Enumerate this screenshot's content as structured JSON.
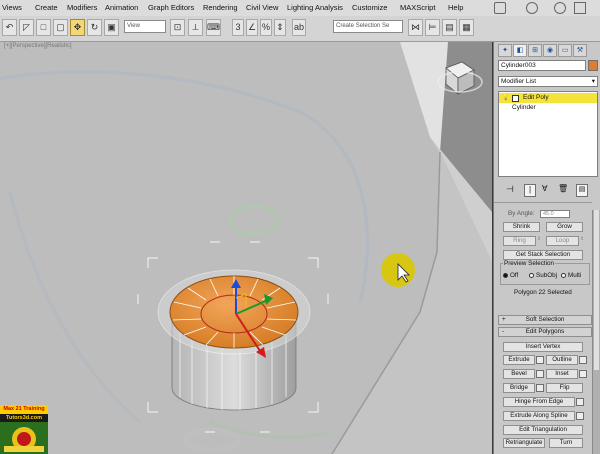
{
  "menu": [
    "Views",
    "Create",
    "Modifiers",
    "Animation",
    "Graph Editors",
    "Rendering",
    "Civil View",
    "Lighting Analysis",
    "Customize",
    "MAXScript",
    "Help"
  ],
  "toolbar": {
    "view_combo": "View",
    "selection_set_placeholder": "Create Selection Se"
  },
  "viewport": {
    "label": "[+][Perspective][Realistic]"
  },
  "panel": {
    "object_name": "Cylinder003",
    "modifier_list": "Modifier List",
    "stack": [
      "Edit Poly",
      "Cylinder"
    ],
    "by_angle_label": "By Angle:",
    "by_angle_value": "45.0",
    "shrink": "Shrink",
    "grow": "Grow",
    "ring": "Ring",
    "loop": "Loop",
    "get_stack_selection": "Get Stack Selection",
    "preview_selection_title": "Preview Selection",
    "preview_off": "Off",
    "preview_subobj": "SubObj",
    "preview_multi": "Multi",
    "selection_status": "Polygon 22 Selected",
    "soft_selection": "Soft Selection",
    "edit_polygons": "Edit Polygons",
    "insert_vertex": "Insert Vertex",
    "extrude": "Extrude",
    "outline": "Outline",
    "bevel": "Bevel",
    "inset": "Inset",
    "bridge": "Bridge",
    "flip": "Flip",
    "hinge_from_edge": "Hinge From Edge",
    "extrude_along_spline": "Extrude Along Spline",
    "edit_triangulation": "Edit Triangulation",
    "retriangulate": "Retriangulate",
    "turn": "Turn",
    "rollout_plus": "+",
    "rollout_minus": "-"
  },
  "logo": {
    "line1": "Max 21 Training",
    "line2": "Tutors3d.com"
  },
  "colors": {
    "selected_face": "#e8913a",
    "selected_stack_item": "#f5e23a",
    "cursor_highlight": "#d9c800"
  }
}
